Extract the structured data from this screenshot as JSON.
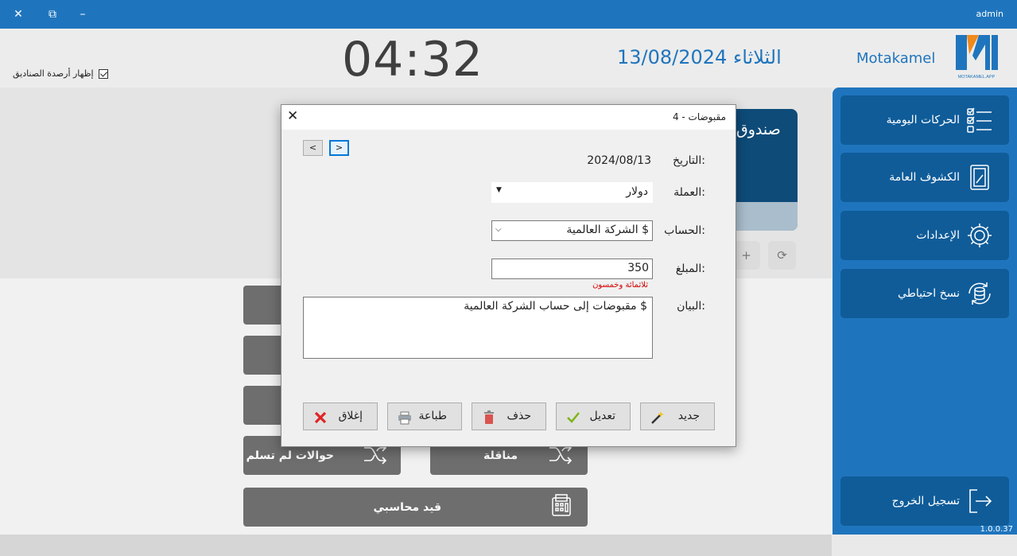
{
  "titlebar": {
    "user": "admin",
    "close": "✕",
    "restore": "⧉",
    "minimize": "–"
  },
  "header": {
    "clock": "04:32",
    "date": "الثلاثاء 13/08/2024",
    "brand": "Motakamel",
    "logo_text": "MOTAKAMEL.APP",
    "show_balances_label": "إظهار أرصدة الصناديق",
    "show_balances_checked": true
  },
  "box_card": {
    "title": "صندوق"
  },
  "toolbar": {
    "refresh": "⟳",
    "add": "+"
  },
  "main_buttons": {
    "unreceived_transfers": "حوالات لم تسلم",
    "transfer": "مناقلة",
    "journal_entry": "قيد محاسبي"
  },
  "sidebar": {
    "items": [
      {
        "label": "الحركات اليومية",
        "icon": "checklist-icon"
      },
      {
        "label": "الكشوف العامة",
        "icon": "report-icon"
      },
      {
        "label": "الإعدادات",
        "icon": "gear-icon"
      },
      {
        "label": "نسخ احتياطي",
        "icon": "database-sync-icon"
      }
    ],
    "logout": "تسجيل الخروج",
    "version": "1.0.0.37"
  },
  "dialog": {
    "title": "مقبوضات - 4",
    "prev": "<",
    "next": ">",
    "date_label": "التاريخ:",
    "date_value": "2024/08/13",
    "currency_label": "العملة:",
    "currency_value": "دولار",
    "account_label": "الحساب:",
    "account_value": "الشركة العالمية $",
    "amount_label": "المبلغ:",
    "amount_value": "350",
    "amount_words": "ثلاثمائة وخمسون",
    "statement_label": "البيان:",
    "statement_value": "مقبوضات إلى حساب الشركة العالمية $",
    "buttons": {
      "new": "جديد",
      "edit": "تعديل",
      "delete": "حذف",
      "print": "طباعة",
      "close": "إغلاق"
    }
  },
  "colors": {
    "brand_blue": "#1f75bd",
    "dark_blue": "#0f5c99",
    "gray_button": "#6e6e6e",
    "error_red": "#d40000"
  }
}
